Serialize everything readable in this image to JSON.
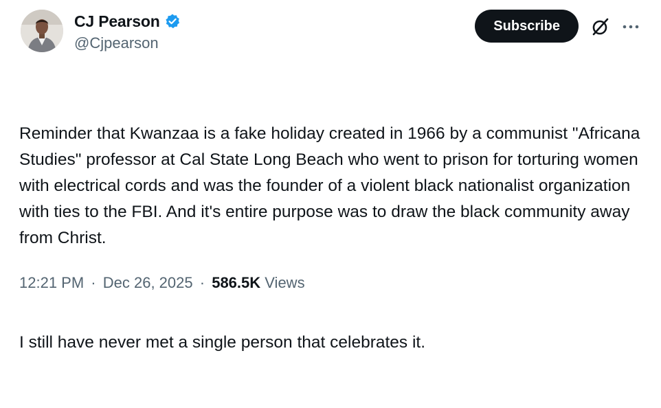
{
  "author": {
    "display_name": "CJ Pearson",
    "handle": "@Cjpearson",
    "verified": true,
    "verified_color": "#1d9bf0"
  },
  "actions": {
    "subscribe_label": "Subscribe",
    "grok_icon": "grok-icon",
    "more_icon": "more-options-icon"
  },
  "post": {
    "paragraph_1": "Reminder that Kwanzaa is a fake holiday created in 1966 by a communist \"Africana Studies\" professor at Cal State Long Beach who went to prison for torturing women with electrical cords and was the founder of a violent black nationalist organization with ties to the FBI. And it's entire purpose was to draw the black community away from Christ.",
    "paragraph_2": "I still have never met a single person that celebrates it."
  },
  "meta": {
    "time": "12:21 PM",
    "separator": "·",
    "date": "Dec 26, 2025",
    "views_count": "586.5K",
    "views_label": "Views"
  },
  "colors": {
    "text": "#0f1419",
    "secondary": "#536471",
    "button_bg": "#0f1419",
    "button_text": "#ffffff"
  }
}
